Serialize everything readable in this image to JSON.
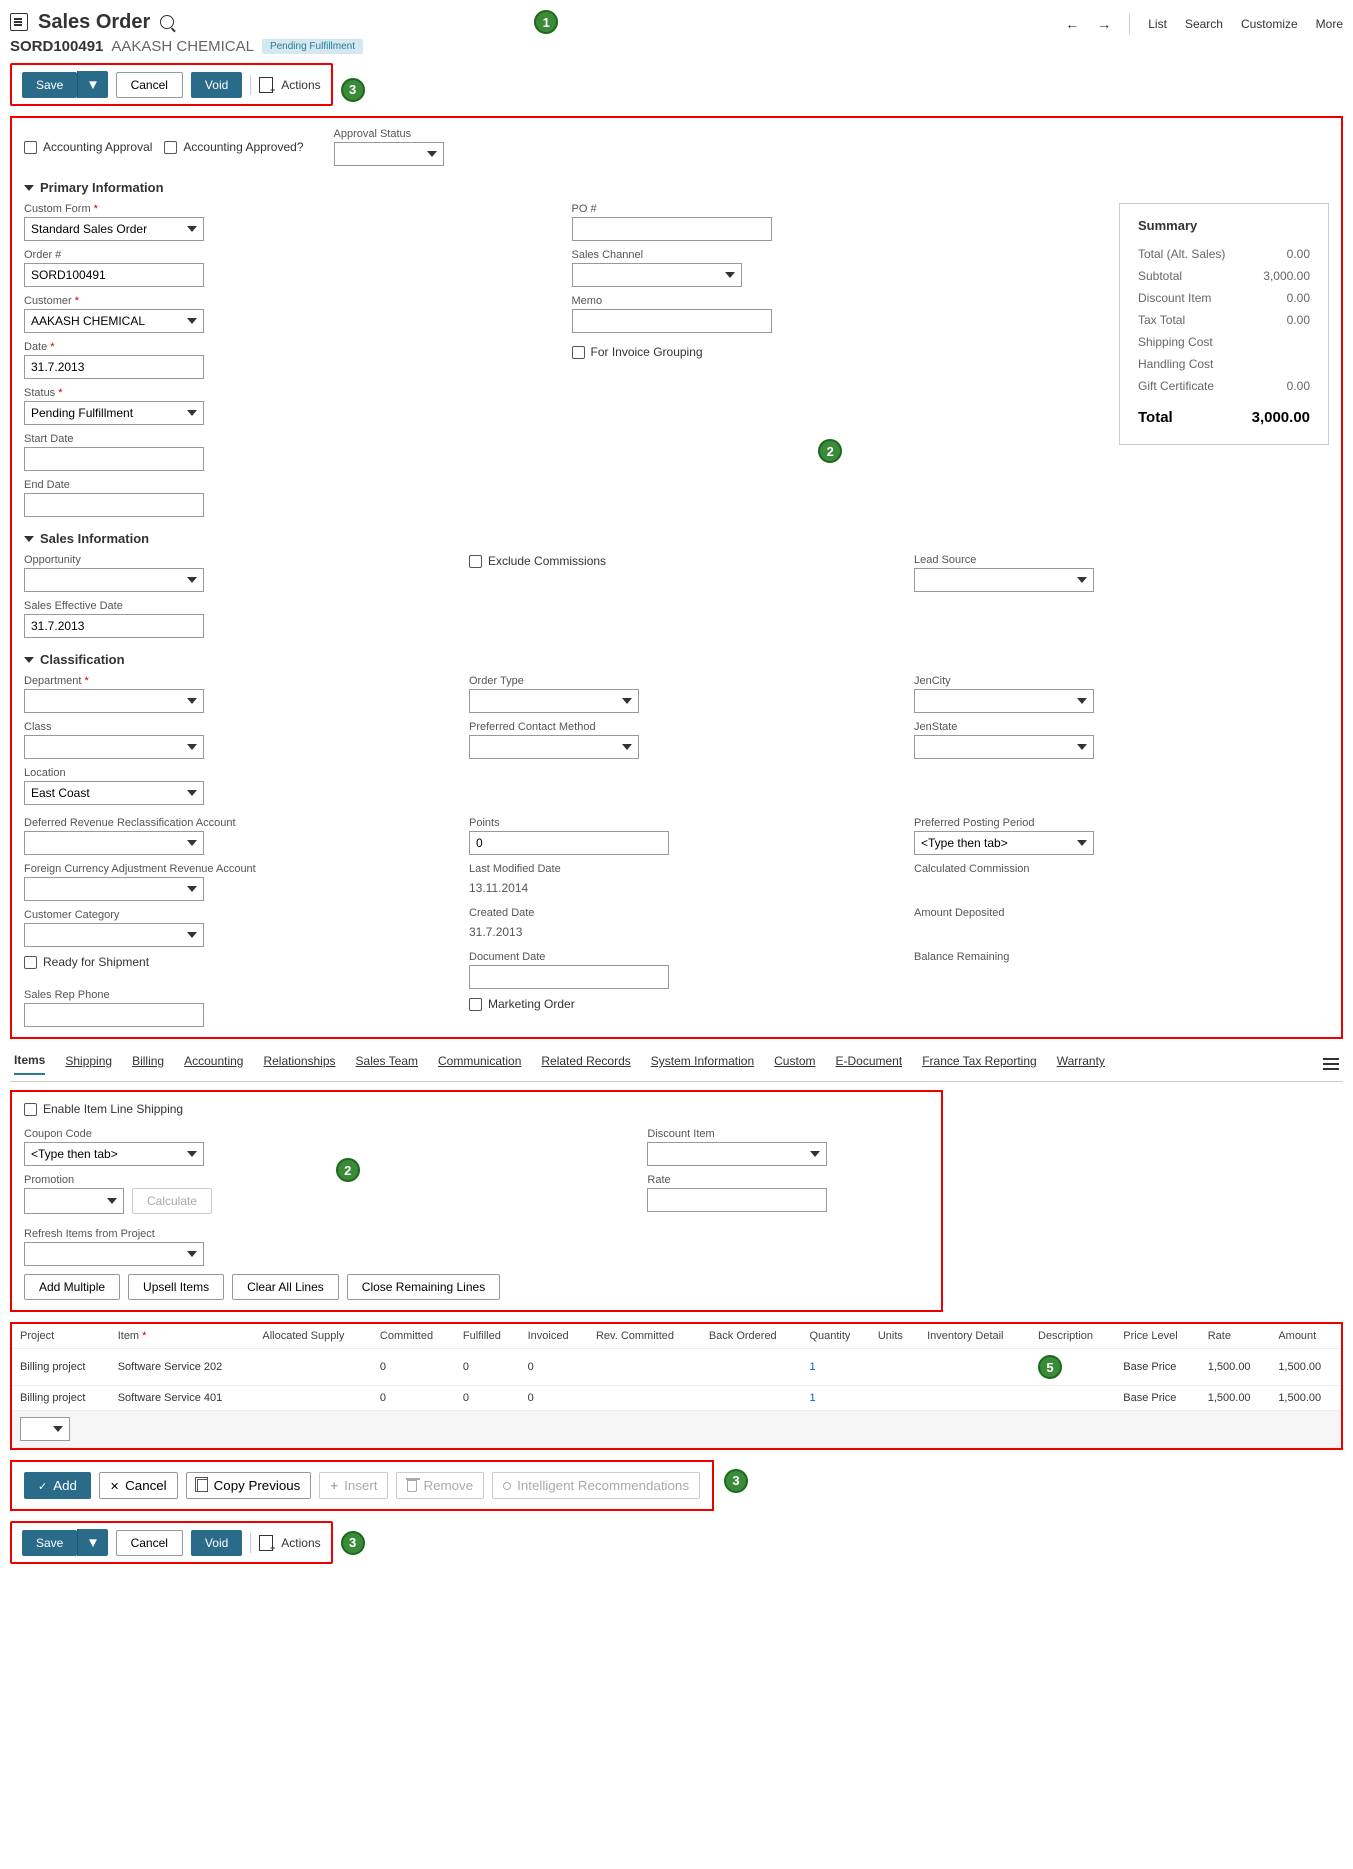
{
  "header": {
    "title": "Sales Order",
    "order_num": "SORD100491",
    "customer": "AAKASH CHEMICAL",
    "status_badge": "Pending Fulfillment",
    "nav": {
      "list": "List",
      "search": "Search",
      "customize": "Customize",
      "more": "More"
    }
  },
  "toolbar": {
    "save": "Save",
    "cancel": "Cancel",
    "void": "Void",
    "actions": "Actions"
  },
  "approval": {
    "accounting_approval": "Accounting Approval",
    "accounting_approved": "Accounting Approved?",
    "approval_status": "Approval Status"
  },
  "primary": {
    "title": "Primary Information",
    "custom_form": {
      "label": "Custom Form",
      "value": "Standard Sales Order"
    },
    "order": {
      "label": "Order #",
      "value": "SORD100491"
    },
    "customer": {
      "label": "Customer",
      "value": "AAKASH  CHEMICAL"
    },
    "date": {
      "label": "Date",
      "value": "31.7.2013"
    },
    "status": {
      "label": "Status",
      "value": "Pending Fulfillment"
    },
    "start_date": {
      "label": "Start Date",
      "value": ""
    },
    "end_date": {
      "label": "End Date",
      "value": ""
    },
    "po": {
      "label": "PO #"
    },
    "sales_channel": {
      "label": "Sales Channel"
    },
    "memo": {
      "label": "Memo"
    },
    "invoice_grouping": "For Invoice Grouping"
  },
  "summary": {
    "title": "Summary",
    "rows": [
      {
        "label": "Total (Alt. Sales)",
        "value": "0.00"
      },
      {
        "label": "Subtotal",
        "value": "3,000.00"
      },
      {
        "label": "Discount Item",
        "value": "0.00"
      },
      {
        "label": "Tax Total",
        "value": "0.00"
      },
      {
        "label": "Shipping Cost",
        "value": ""
      },
      {
        "label": "Handling Cost",
        "value": ""
      },
      {
        "label": "Gift Certificate",
        "value": "0.00"
      }
    ],
    "total": {
      "label": "Total",
      "value": "3,000.00"
    }
  },
  "sales_info": {
    "title": "Sales Information",
    "opportunity": "Opportunity",
    "sales_eff_date": {
      "label": "Sales Effective Date",
      "value": "31.7.2013"
    },
    "exclude_comm": "Exclude Commissions",
    "lead_source": "Lead Source"
  },
  "classification": {
    "title": "Classification",
    "department": "Department",
    "class": "Class",
    "location": {
      "label": "Location",
      "value": "East Coast"
    },
    "order_type": "Order Type",
    "preferred_contact": "Preferred Contact Method",
    "jen_city": "JenCity",
    "jen_state": "JenState",
    "deferred_rev": "Deferred Revenue Reclassification Account",
    "fca": "Foreign Currency Adjustment Revenue Account",
    "cust_cat": "Customer Category",
    "ready_ship": "Ready for Shipment",
    "sales_rep_phone": "Sales Rep Phone",
    "points": {
      "label": "Points",
      "value": "0"
    },
    "last_mod": {
      "label": "Last Modified Date",
      "value": "13.11.2014"
    },
    "created": {
      "label": "Created Date",
      "value": "31.7.2013"
    },
    "doc_date": "Document Date",
    "marketing_order": "Marketing Order",
    "pref_posting": {
      "label": "Preferred Posting Period",
      "placeholder": "<Type then tab>"
    },
    "calc_comm": "Calculated Commission",
    "amt_dep": "Amount Deposited",
    "bal_rem": "Balance Remaining"
  },
  "tabs": [
    "Items",
    "Shipping",
    "Billing",
    "Accounting",
    "Relationships",
    "Sales Team",
    "Communication",
    "Related Records",
    "System Information",
    "Custom",
    "E-Document",
    "France Tax Reporting",
    "Warranty"
  ],
  "items_panel": {
    "enable_line_ship": "Enable Item Line Shipping",
    "coupon": {
      "label": "Coupon Code",
      "placeholder": "<Type then tab>"
    },
    "promotion": "Promotion",
    "calculate": "Calculate",
    "discount_item": "Discount Item",
    "rate": "Rate",
    "refresh": "Refresh Items from Project",
    "add_multiple": "Add Multiple",
    "upsell": "Upsell Items",
    "clear_all": "Clear All Lines",
    "close_remaining": "Close Remaining Lines"
  },
  "table": {
    "headers": [
      "Project",
      "Item",
      "Allocated Supply",
      "Committed",
      "Fulfilled",
      "Invoiced",
      "Rev. Committed",
      "Back Ordered",
      "Quantity",
      "Units",
      "Inventory Detail",
      "Description",
      "Price Level",
      "Rate",
      "Amount"
    ],
    "rows": [
      {
        "project": "Billing project",
        "item": "Software Service 202",
        "committed": "0",
        "fulfilled": "0",
        "invoiced": "0",
        "qty": "1",
        "price_level": "Base Price",
        "rate": "1,500.00",
        "amount": "1,500.00"
      },
      {
        "project": "Billing project",
        "item": "Software Service 401",
        "committed": "0",
        "fulfilled": "0",
        "invoiced": "0",
        "qty": "1",
        "price_level": "Base Price",
        "rate": "1,500.00",
        "amount": "1,500.00"
      }
    ]
  },
  "line_actions": {
    "add": "Add",
    "cancel": "Cancel",
    "copy": "Copy Previous",
    "insert": "Insert",
    "remove": "Remove",
    "intel": "Intelligent Recommendations"
  },
  "callouts": {
    "c1": "1",
    "c2": "2",
    "c3": "3",
    "c5": "5"
  }
}
